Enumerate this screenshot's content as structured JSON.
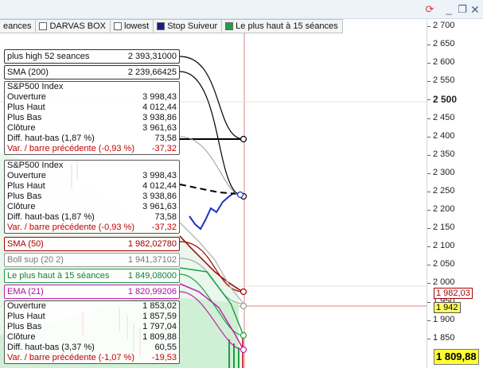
{
  "window": {
    "icons": {
      "refresh": "refresh-icon",
      "minimize": "minimize-icon",
      "restore": "restore-icon",
      "close": "close-icon"
    },
    "glyphs": {
      "refresh": "⟳",
      "minimize": "_",
      "restore": "❐",
      "close": "✕"
    }
  },
  "legend": [
    {
      "label": "eances",
      "color": "#ffffff"
    },
    {
      "label": "DARVAS BOX",
      "color": "#ffffff"
    },
    {
      "label": "lowest",
      "color": "#ffffff"
    },
    {
      "label": "Stop Suiveur",
      "color": "#1a1a8c"
    },
    {
      "label": "Le plus haut à 15 séances",
      "color": "#1aa046"
    }
  ],
  "axis": {
    "ticks": [
      "2 700",
      "2 650",
      "2 600",
      "2 550",
      "2 500",
      "2 450",
      "2 400",
      "2 350",
      "2 300",
      "2 250",
      "2 200",
      "2 150",
      "2 100",
      "2 050",
      "2 000",
      "1 950",
      "1 900",
      "1 850"
    ],
    "major": "2 500",
    "badges": {
      "sma50": "1 982,03",
      "price": "1 942",
      "last": "1 809,88"
    }
  },
  "boxes": {
    "high52": {
      "label": "plus high 52 seances",
      "value": "2 393,31000",
      "border": "#333333",
      "color": "#000000"
    },
    "sma200": {
      "label": "SMA (200)",
      "value": "2 239,66425",
      "border": "#333333",
      "color": "#000000"
    },
    "ohlc1": {
      "title": "S&P500 Index",
      "rows": [
        {
          "label": "Ouverture",
          "value": "3 998,43"
        },
        {
          "label": "Plus Haut",
          "value": "4 012,44"
        },
        {
          "label": "Plus Bas",
          "value": "3 938,86"
        },
        {
          "label": "Clôture",
          "value": "3 961,63"
        },
        {
          "label": "Diff. haut-bas (1,87 %)",
          "value": "73,58"
        }
      ],
      "var": {
        "label": "Var. / barre précédente (-0,93 %)",
        "value": "-37,32"
      }
    },
    "ohlc2": {
      "title": "S&P500 Index",
      "rows": [
        {
          "label": "Ouverture",
          "value": "3 998,43"
        },
        {
          "label": "Plus Haut",
          "value": "4 012,44"
        },
        {
          "label": "Plus Bas",
          "value": "3 938,86"
        },
        {
          "label": "Clôture",
          "value": "3 961,63"
        },
        {
          "label": "Diff. haut-bas (1,87 %)",
          "value": "73,58"
        }
      ],
      "var": {
        "label": "Var. / barre précédente (-0,93 %)",
        "value": "-37,32"
      }
    },
    "sma50": {
      "label": "SMA (50)",
      "value": "1 982,02780",
      "border": "#a00000",
      "color": "#a00000"
    },
    "boll": {
      "label": "Boll sup (20 2)",
      "value": "1 941,37102",
      "border": "#999999",
      "color": "#777777"
    },
    "high15": {
      "label": "Le plus haut à 15 séances",
      "value": "1 849,08000",
      "border": "#1aa046",
      "color": "#138036"
    },
    "ema21": {
      "label": "EMA (21)",
      "value": "1 820,99206",
      "border": "#c020b0",
      "color": "#b0109f"
    },
    "ohlc3": {
      "rows": [
        {
          "label": "Ouverture",
          "value": "1 853,02"
        },
        {
          "label": "Plus Haut",
          "value": "1 857,59"
        },
        {
          "label": "Plus Bas",
          "value": "1 797,04"
        },
        {
          "label": "Clôture",
          "value": "1 809,88"
        },
        {
          "label": "Diff. haut-bas (3,37 %)",
          "value": "60,55"
        }
      ],
      "var": {
        "label": "Var. / barre précédente (-1,07 %)",
        "value": "-19,53"
      }
    }
  },
  "colors": {
    "stop": "#2030c0",
    "sma50": "#a00000",
    "high15": "#1aa046",
    "ema21": "#c020b0",
    "high52": "#000000",
    "cursor": "#e07070"
  }
}
